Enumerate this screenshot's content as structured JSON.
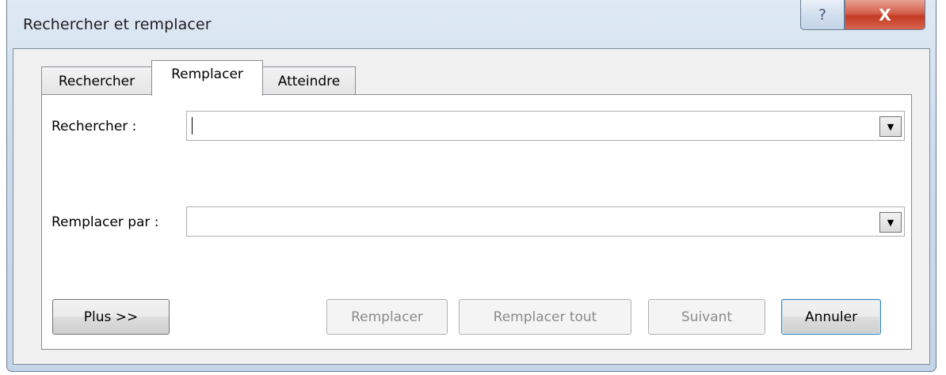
{
  "window": {
    "title": "Rechercher et remplacer",
    "help_glyph": "?",
    "close_glyph": "X"
  },
  "tabs": [
    {
      "label": "Rechercher",
      "active": false
    },
    {
      "label": "Remplacer",
      "active": true
    },
    {
      "label": "Atteindre",
      "active": false
    }
  ],
  "fields": {
    "find": {
      "label": "Rechercher :",
      "value": ""
    },
    "replace": {
      "label": "Remplacer par :",
      "value": ""
    },
    "dropdown_glyph": "▼"
  },
  "buttons": {
    "more": {
      "label": "Plus >>",
      "enabled": true
    },
    "replace": {
      "label": "Remplacer",
      "enabled": false
    },
    "replace_all": {
      "label": "Remplacer tout",
      "enabled": false
    },
    "next": {
      "label": "Suivant",
      "enabled": false
    },
    "cancel": {
      "label": "Annuler",
      "enabled": true
    }
  }
}
